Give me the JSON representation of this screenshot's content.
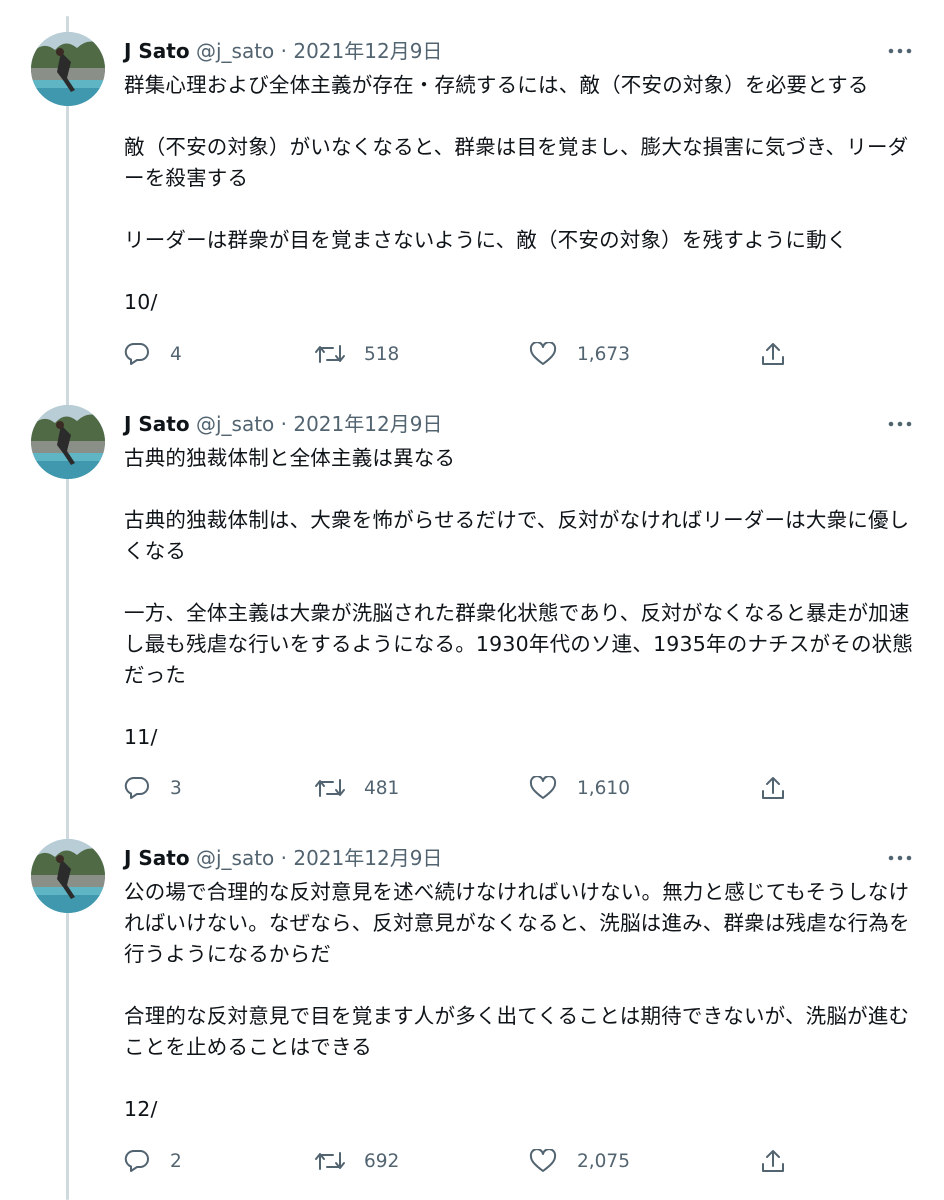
{
  "author": {
    "name": "J Sato",
    "handle": "@j_sato",
    "separator": "·"
  },
  "tweets": [
    {
      "date": "2021年12月9日",
      "paragraphs": [
        "群集心理および全体主義が存在・存続するには、敵（不安の対象）を必要とする",
        "敵（不安の対象）がいなくなると、群衆は目を覚まし、膨大な損害に気づき、リーダーを殺害する",
        "リーダーは群衆が目を覚まさないように、敵（不安の対象）を残すように動く",
        "10/"
      ],
      "replies": "4",
      "retweets": "518",
      "likes": "1,673"
    },
    {
      "date": "2021年12月9日",
      "paragraphs": [
        "古典的独裁体制と全体主義は異なる",
        "古典的独裁体制は、大衆を怖がらせるだけで、反対がなければリーダーは大衆に優しくなる",
        "一方、全体主義は大衆が洗脳された群衆化状態であり、反対がなくなると暴走が加速し最も残虐な行いをするようになる。1930年代のソ連、1935年のナチスがその状態だった",
        "11/"
      ],
      "replies": "3",
      "retweets": "481",
      "likes": "1,610"
    },
    {
      "date": "2021年12月9日",
      "paragraphs": [
        "公の場で合理的な反対意見を述べ続けなければいけない。無力と感じてもそうしなければいけない。なぜなら、反対意見がなくなると、洗脳は進み、群衆は残虐な行為を行うようになるからだ",
        "合理的な反対意見で目を覚ます人が多く出てくることは期待できないが、洗脳が進むことを止めることはできる",
        "12/"
      ],
      "replies": "2",
      "retweets": "692",
      "likes": "2,075"
    }
  ],
  "icons": {
    "more": "more-icon",
    "reply": "reply-icon",
    "retweet": "retweet-icon",
    "like": "like-icon",
    "share": "share-icon"
  },
  "colors": {
    "text": "#0f1419",
    "secondary": "#536471",
    "thread_line": "#cfd9de",
    "background": "#ffffff"
  }
}
